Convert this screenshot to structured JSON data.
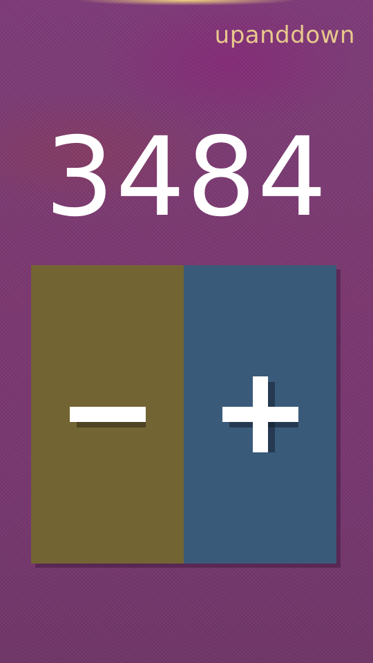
{
  "app": {
    "title": "upanddown"
  },
  "counter": {
    "value": "3484"
  },
  "controls": {
    "decrement_icon": "minus-icon",
    "increment_icon": "plus-icon",
    "decrement_color": "#736533",
    "increment_color": "#3a5a7a",
    "icon_color": "#ffffff"
  }
}
